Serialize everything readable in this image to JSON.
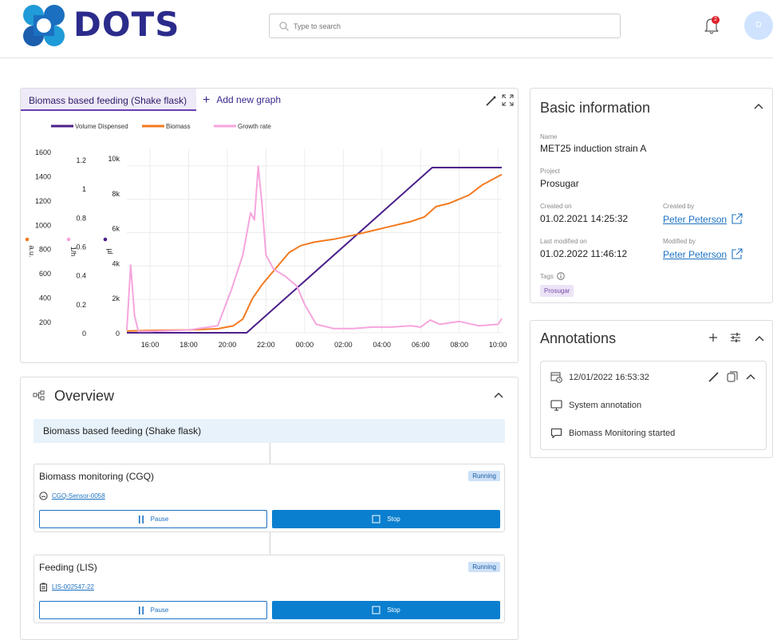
{
  "app": {
    "name": "DOTS"
  },
  "header": {
    "search_placeholder": "Type to search",
    "notification_count": "2",
    "avatar_initial": "D"
  },
  "graph": {
    "tabs": [
      {
        "label": "Biomass based feeding (Shake flask)"
      }
    ],
    "add_tab_label": "Add new graph"
  },
  "chart_data": {
    "type": "line",
    "title": "",
    "legend": [
      "Volume Dispensed",
      "Biomass",
      "Growth rate"
    ],
    "legend_placement": "top-left",
    "x": {
      "label": "",
      "ticks": [
        "16:00",
        "18:00",
        "20:00",
        "22:00",
        "00:00",
        "02:00",
        "04:00",
        "06:00",
        "08:00",
        "10:00"
      ]
    },
    "y_axes": [
      {
        "unit": "a.u.",
        "series": "Biomass",
        "ticks": [
          "1600",
          "1400",
          "1200",
          "1000",
          "800",
          "600",
          "400",
          "200"
        ],
        "range": [
          0,
          1600
        ]
      },
      {
        "unit": "1/h",
        "series": "Growth rate",
        "ticks": [
          "1.2",
          "1",
          "0.8",
          "0.6",
          "0.4",
          "0.2",
          "0"
        ],
        "range": [
          0,
          1.3
        ]
      },
      {
        "unit": "µl",
        "series": "Volume Dispensed",
        "ticks": [
          "10k",
          "8k",
          "6k",
          "4k",
          "2k",
          "0"
        ],
        "range": [
          0,
          11000
        ]
      }
    ],
    "grid": true,
    "series": [
      {
        "name": "Volume Dispensed",
        "color": "#4b1f8a",
        "axis": 2,
        "x": [
          14.8,
          20.5,
          21.0,
          30.6,
          34.2
        ],
        "y": [
          0,
          0,
          0,
          9900,
          9900
        ]
      },
      {
        "name": "Biomass",
        "color": "#f47a20",
        "axis": 0,
        "x": [
          14.8,
          16,
          18,
          19.5,
          20.3,
          20.8,
          21.3,
          21.8,
          22.5,
          23.2,
          23.8,
          24.5,
          25.5,
          26.5,
          27.5,
          28.5,
          29.5,
          30.2,
          30.8,
          31.5,
          32.5,
          33.2,
          34.2
        ],
        "y": [
          15,
          20,
          25,
          35,
          60,
          120,
          300,
          420,
          560,
          700,
          760,
          790,
          815,
          850,
          890,
          930,
          970,
          1010,
          1100,
          1130,
          1200,
          1290,
          1380
        ]
      },
      {
        "name": "Growth rate",
        "color": "#f6a5dd",
        "axis": 1,
        "x": [
          14.8,
          15.0,
          15.2,
          15.4,
          16.0,
          18.0,
          19.5,
          20.2,
          20.8,
          21.2,
          21.4,
          21.6,
          21.8,
          22.0,
          22.4,
          23.0,
          23.6,
          24.0,
          24.6,
          25.5,
          26.5,
          27.5,
          28.5,
          29.5,
          30.0,
          30.5,
          31.0,
          32.0,
          33.0,
          34.0,
          34.2
        ],
        "y": [
          0.02,
          0.48,
          0.12,
          0.01,
          0.01,
          0.02,
          0.05,
          0.3,
          0.55,
          0.85,
          0.8,
          1.18,
          0.9,
          0.55,
          0.45,
          0.4,
          0.33,
          0.2,
          0.06,
          0.03,
          0.03,
          0.04,
          0.04,
          0.05,
          0.04,
          0.09,
          0.06,
          0.08,
          0.05,
          0.06,
          0.1
        ]
      }
    ]
  },
  "basic_info": {
    "title": "Basic information",
    "name_label": "Name",
    "name_value": "MET25 induction strain A",
    "project_label": "Project",
    "project_value": "Prosugar",
    "created_on_label": "Created on",
    "created_on_value": "01.02.2021 14:25:32",
    "created_by_label": "Created by",
    "created_by_value": "Peter Peterson",
    "modified_on_label": "Last modified on",
    "modified_on_value": "01.02.2022 11:46:12",
    "modified_by_label": "Modified by",
    "modified_by_value": "Peter Peterson",
    "tags_label": "Tags",
    "tags": [
      "Prosugar"
    ]
  },
  "annotations": {
    "title": "Annotations",
    "items": [
      {
        "timestamp": "12/01/2022 16:53:32",
        "type": "System annotation",
        "text": "Biomass Monitoring started"
      }
    ]
  },
  "overview": {
    "title": "Overview",
    "root": "Biomass based feeding (Shake flask)",
    "steps": [
      {
        "title": "Biomass monitoring (CGQ)",
        "status": "Running",
        "device": "CGQ-Sensor-0058",
        "pause_label": "Pause",
        "stop_label": "Stop"
      },
      {
        "title": "Feeding (LIS)",
        "status": "Running",
        "device": "LIS-002547-22",
        "pause_label": "Pause",
        "stop_label": "Stop"
      }
    ]
  },
  "colors": {
    "brand": "#2b2b8c",
    "accent": "#0b7fcf",
    "tab_accent": "#6a3fb0"
  }
}
